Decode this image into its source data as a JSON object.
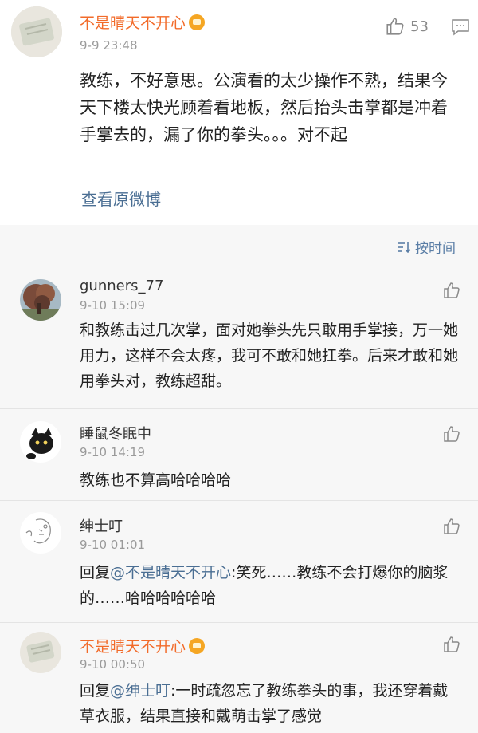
{
  "post": {
    "username": "不是晴天不开心",
    "time": "9-9 23:48",
    "likes": "53",
    "text": "教练，不好意思。公演看的太少操作不熟，结果今天下楼太快光顾着看地板，然后抬头击掌都是冲着手掌去的，漏了你的拳头。。。对不起",
    "view_original": "查看原微博"
  },
  "sort": {
    "label": "按时间"
  },
  "comments": [
    {
      "username": "gunners_77",
      "time": "9-10 15:09",
      "text": "和教练击过几次掌，面对她拳头先只敢用手掌接，万一她用力，这样不会太疼，我可不敢和她扛拳。后来才敢和她用拳头对，教练超甜。"
    },
    {
      "username": "睡鼠冬眠中",
      "time": "9-10 14:19",
      "text": "教练也不算高哈哈哈哈"
    },
    {
      "username": "绅士叮",
      "time": "9-10 01:01",
      "reply_prefix": "回复",
      "mention": "@不是晴天不开心",
      "text": ":笑死……教练不会打爆你的脑浆的……哈哈哈哈哈哈"
    },
    {
      "username": "不是晴天不开心",
      "time": "9-10 00:50",
      "reply_prefix": "回复",
      "mention": "@绅士叮",
      "text": ":一时疏忽忘了教练拳头的事，我还穿着戴草衣服，结果直接和戴萌击掌了感觉"
    }
  ]
}
